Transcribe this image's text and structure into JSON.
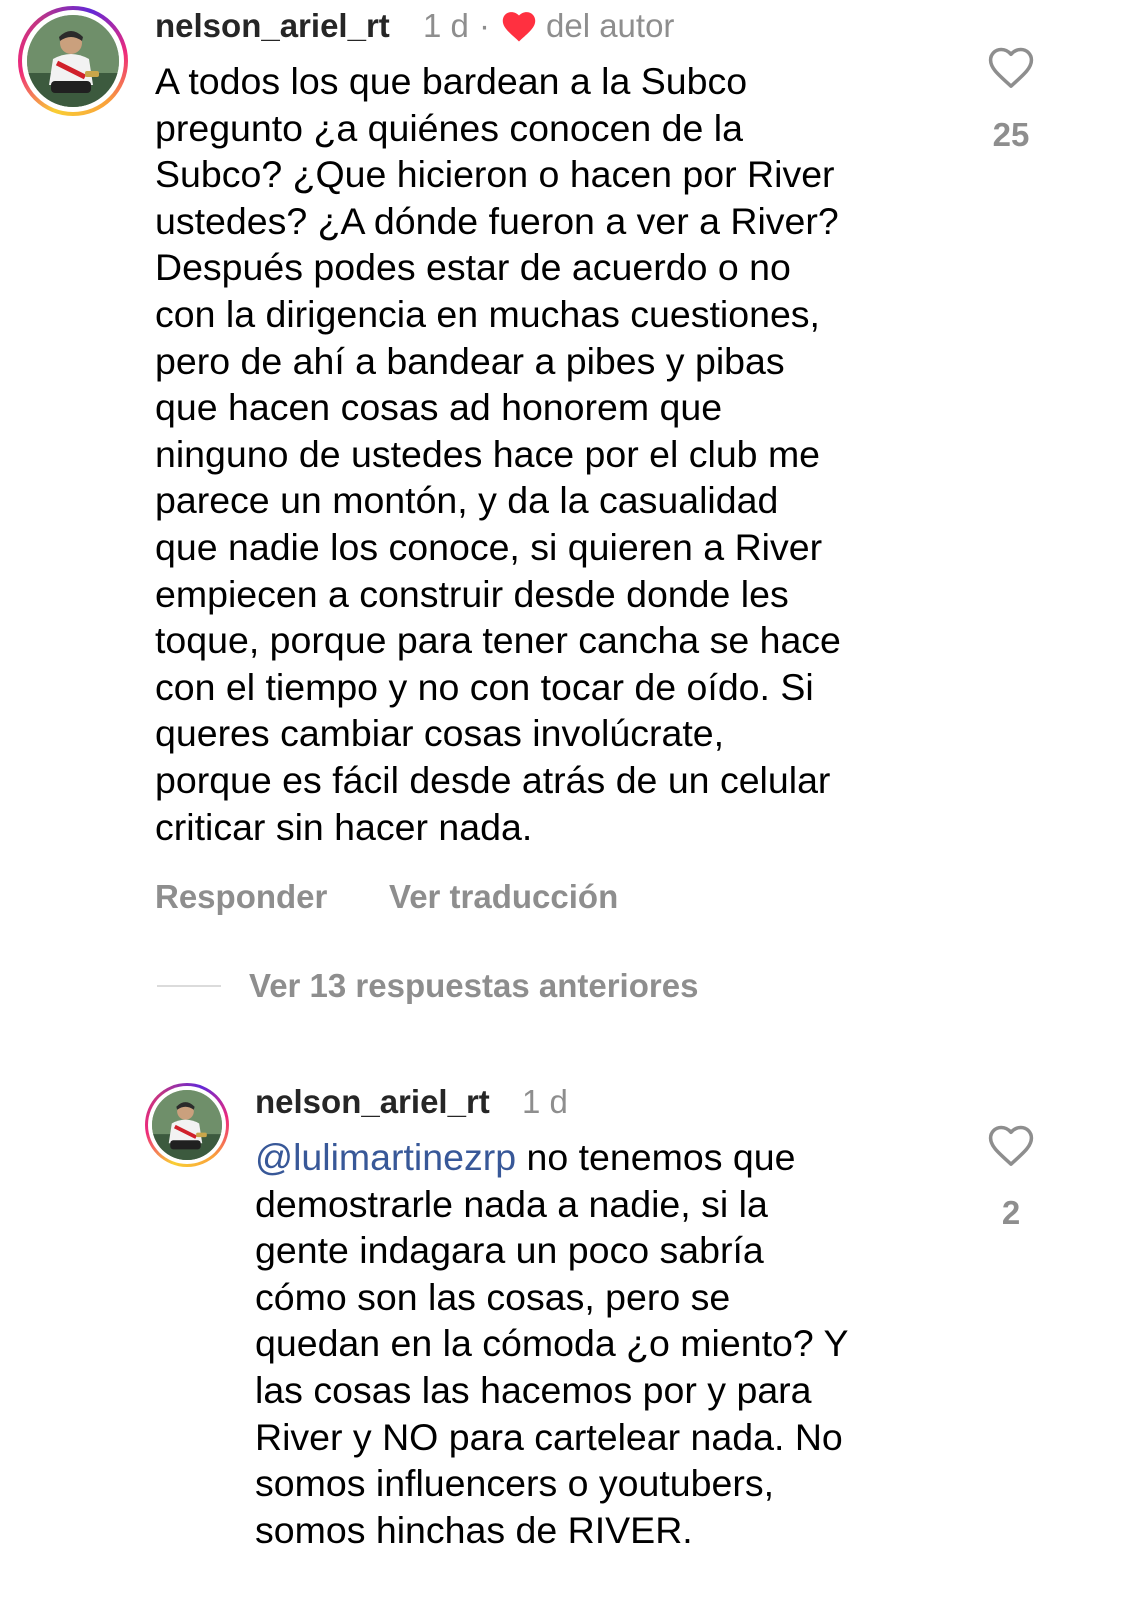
{
  "comment": {
    "username": "nelson_ariel_rt",
    "time": "1 d",
    "separator": "·",
    "author_badge": "del autor",
    "text": "A todos los que bardean a la Subco\npregunto ¿a quiénes conocen de la\nSubco? ¿Que hicieron o hacen por River\nustedes? ¿A dónde fueron a ver a River?\nDespués podes estar de acuerdo o no\ncon la dirigencia en muchas cuestiones,\npero de ahí a bandear a pibes y pibas\nque hacen cosas ad honorem que\nninguno de ustedes hace por el club me\nparece un montón, y da la casualidad\nque nadie los conoce, si quieren a River\nempiecen a construir desde donde les\ntoque, porque para tener cancha se hace\ncon el tiempo y no con tocar de oído. Si\nqueres cambiar cosas involúcrate,\nporque es fácil desde atrás de un celular\ncriticar sin hacer nada.",
    "like_count": "25",
    "reply_label": "Responder",
    "translate_label": "Ver traducción"
  },
  "replies_toggle": {
    "label": "Ver 13 respuestas anteriores"
  },
  "reply": {
    "username": "nelson_ariel_rt",
    "time": "1 d",
    "mention": "@lulimartinezrp",
    "text_first": " no tenemos que",
    "text_rest": "demostrarle nada a nadie, si la\ngente indagara un poco sabría\ncómo son las cosas, pero se\nquedan en la cómoda ¿o miento? Y\nlas cosas las hacemos por y para\nRiver y NO para cartelear nada. No\nsomos influencers o youtubers,\nsomos hinchas de RIVER.",
    "like_count": "2"
  },
  "icons": {
    "author_heart": "heart-filled-icon",
    "like": "heart-outline-icon",
    "author_heart_color": "#ff3040"
  }
}
